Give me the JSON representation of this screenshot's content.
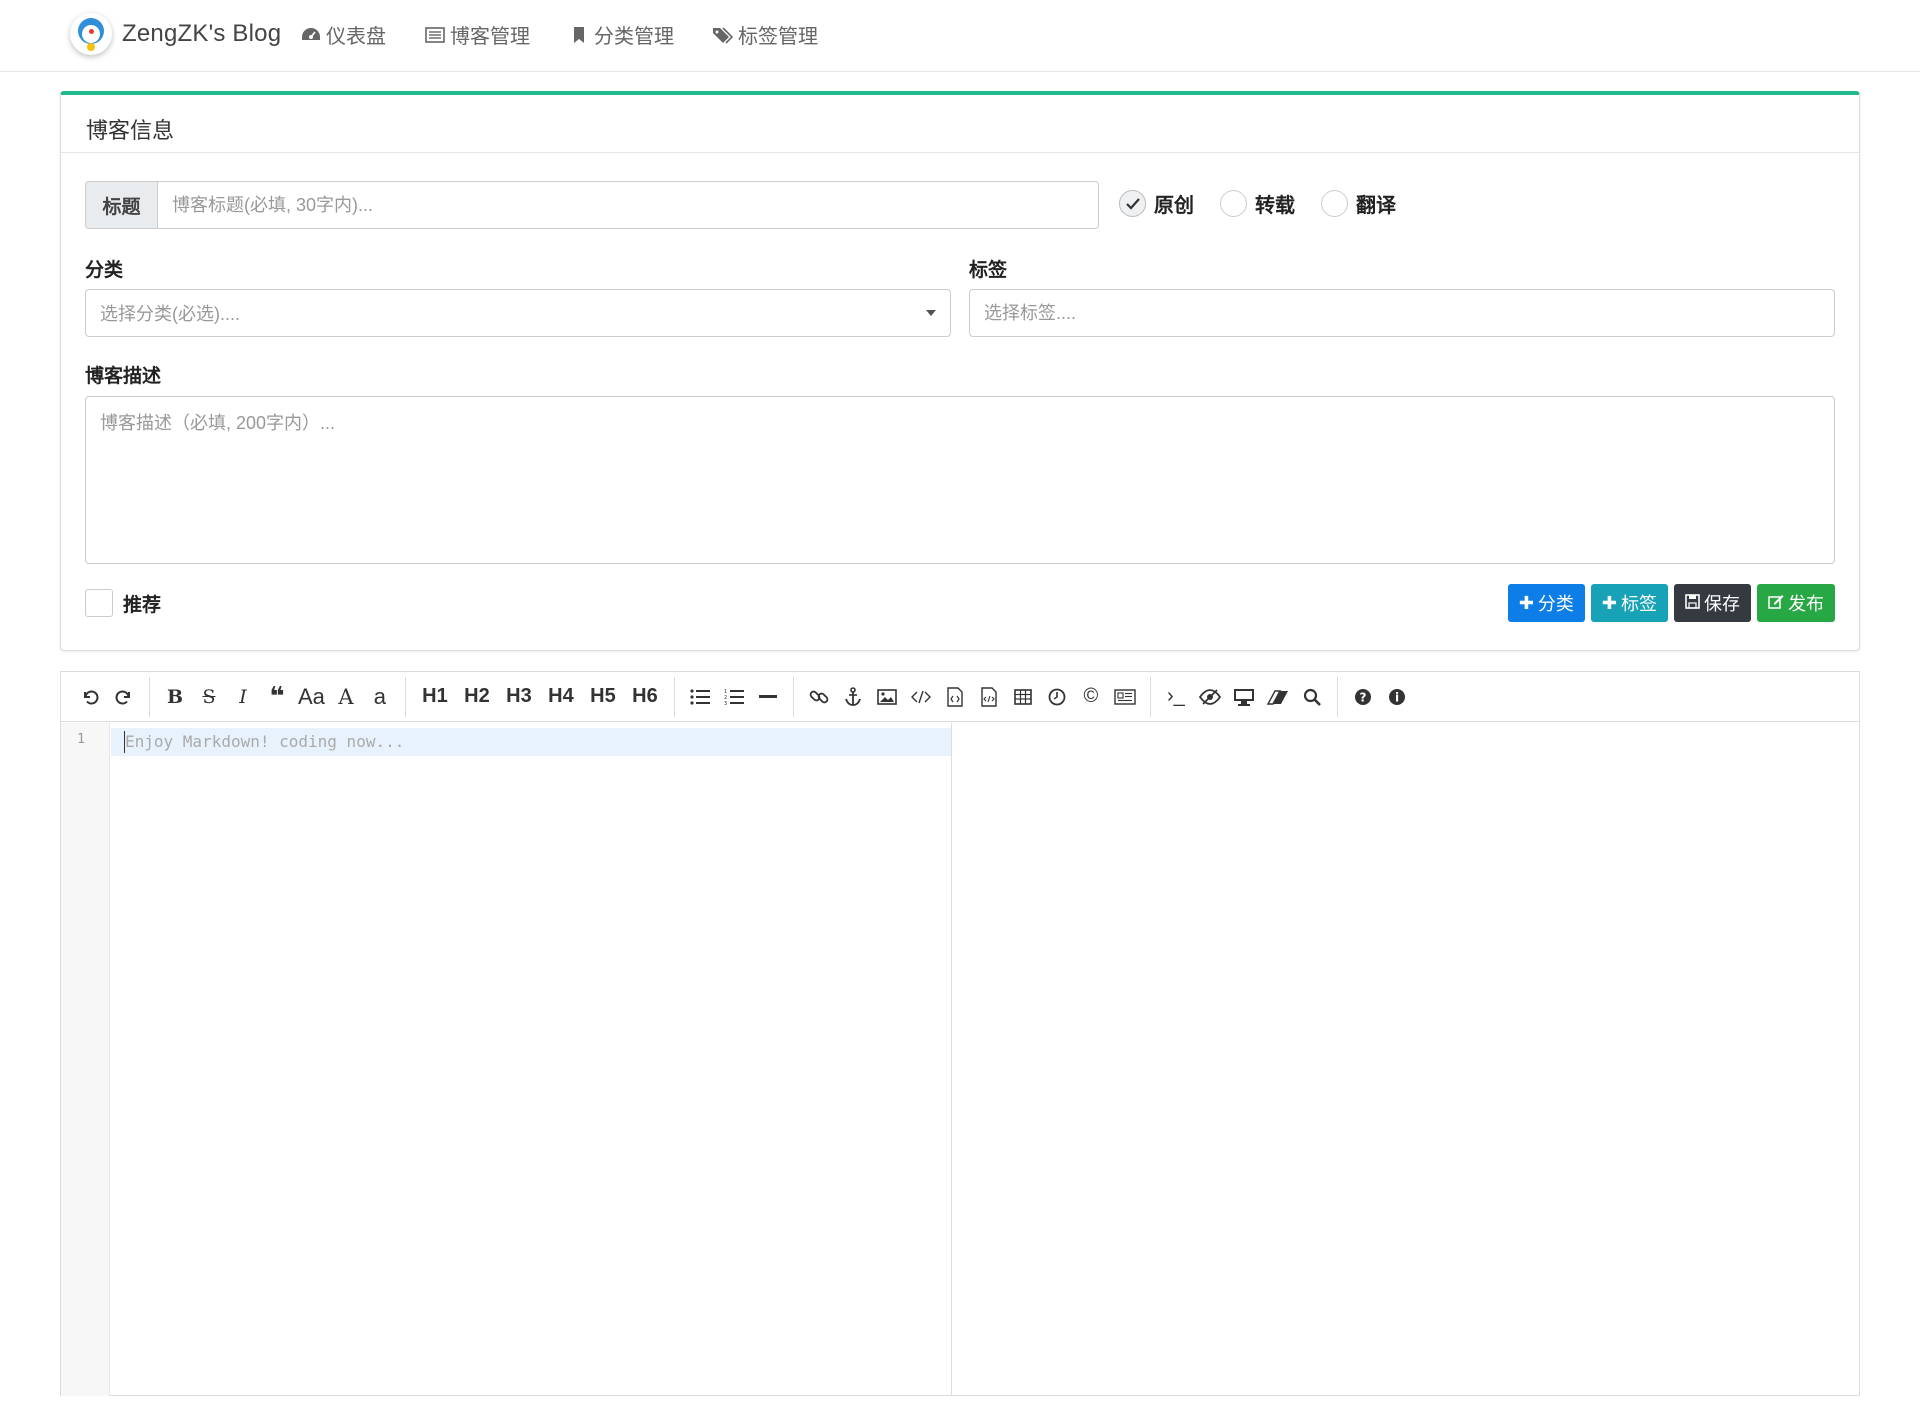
{
  "navbar": {
    "brand": "ZengZK's Blog",
    "items": [
      {
        "label": "仪表盘",
        "icon": "dashboard-icon"
      },
      {
        "label": "博客管理",
        "icon": "list-icon"
      },
      {
        "label": "分类管理",
        "icon": "bookmark-icon"
      },
      {
        "label": "标签管理",
        "icon": "tags-icon"
      }
    ]
  },
  "card": {
    "header": "博客信息",
    "title_label": "标题",
    "title_placeholder": "博客标题(必填, 30字内)...",
    "type_options": [
      {
        "label": "原创",
        "checked": true
      },
      {
        "label": "转载",
        "checked": false
      },
      {
        "label": "翻译",
        "checked": false
      }
    ],
    "category_label": "分类",
    "category_placeholder": "选择分类(必选)....",
    "tags_label": "标签",
    "tags_placeholder": "选择标签....",
    "desc_label": "博客描述",
    "desc_placeholder": "博客描述（必填, 200字内）...",
    "recommend_label": "推荐",
    "buttons": {
      "add_category": "分类",
      "add_tag": "标签",
      "save": "保存",
      "publish": "发布"
    }
  },
  "editor": {
    "toolbar_text": {
      "font_size": "Aa",
      "uppercase": "A",
      "lowercase": "a",
      "h1": "H1",
      "h2": "H2",
      "h3": "H3",
      "h4": "H4",
      "h5": "H5",
      "h6": "H6",
      "terminal": "›_"
    },
    "line_number": "1",
    "placeholder": "Enjoy Markdown! coding now..."
  },
  "colors": {
    "card_accent": "#21ba8c",
    "btn_blue": "#0d7de8",
    "btn_teal": "#17a2b8",
    "btn_dark": "#343a40",
    "btn_green": "#28a745"
  }
}
